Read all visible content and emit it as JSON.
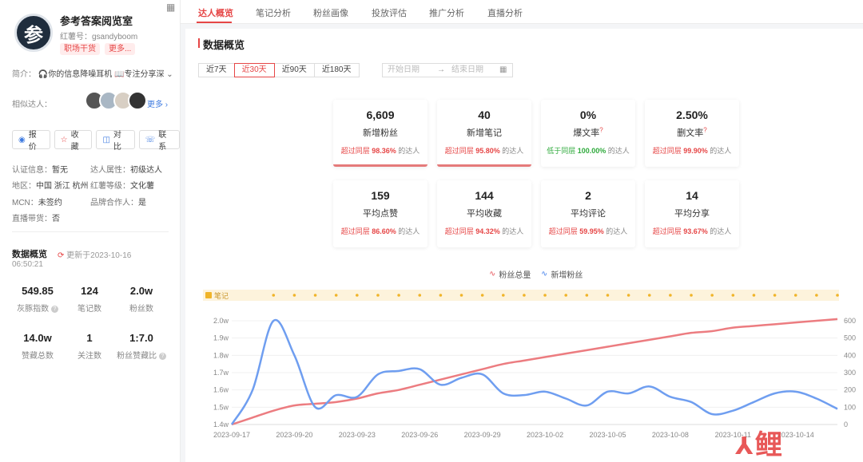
{
  "profile": {
    "avatar_char": "参",
    "name": "参考答案阅览室",
    "red_id": "红薯号：gsandyboom",
    "tags": [
      "职场干货",
      "更多..."
    ],
    "intro_label": "简介：",
    "intro_text": "🎧你的信息降噪耳机 📖专注分享深",
    "similar_label": "相似达人：",
    "more_label": "更多 ›",
    "actions": [
      "报价",
      "收藏",
      "对比",
      "联系"
    ],
    "info": {
      "cert_k": "认证信息：",
      "cert_v": "暂无",
      "attr_k": "达人属性：",
      "attr_v": "初级达人",
      "region_k": "地区：",
      "region_v": "中国 浙江 杭州",
      "level_k": "红薯等级：",
      "level_v": "文化薯",
      "mcn_k": "MCN：",
      "mcn_v": "未签约",
      "brand_k": "品牌合作人：",
      "brand_v": "是",
      "live_k": "直播带货：",
      "live_v": "否"
    },
    "overview_title": "数据概览",
    "updated": "更新于2023-10-16",
    "updated_time": "06:50:21",
    "stats": [
      {
        "value": "549.85",
        "label": "灰豚指数"
      },
      {
        "value": "124",
        "label": "笔记数"
      },
      {
        "value": "2.0w",
        "label": "粉丝数"
      },
      {
        "value": "14.0w",
        "label": "赞藏总数"
      },
      {
        "value": "1",
        "label": "关注数"
      },
      {
        "value": "1:7.0",
        "label": "粉丝赞藏比"
      }
    ]
  },
  "tabs": [
    "达人概览",
    "笔记分析",
    "粉丝画像",
    "投放评估",
    "推广分析",
    "直播分析"
  ],
  "section_title": "数据概览",
  "ranges": [
    "近7天",
    "近30天",
    "近90天",
    "近180天"
  ],
  "date_start": "开始日期",
  "date_end": "结束日期",
  "cards": [
    {
      "value": "6,609",
      "title": "新增粉丝",
      "pre": "超过同层",
      "pct": "98.36%",
      "post": "的达人"
    },
    {
      "value": "40",
      "title": "新增笔记",
      "pre": "超过同层",
      "pct": "95.80%",
      "post": "的达人"
    },
    {
      "value": "0%",
      "title": "爆文率",
      "pre": "低于同层",
      "pct": "100.00%",
      "post": "的达人"
    },
    {
      "value": "2.50%",
      "title": "删文率",
      "pre": "超过同层",
      "pct": "99.90%",
      "post": "的达人"
    },
    {
      "value": "159",
      "title": "平均点赞",
      "pre": "超过同层",
      "pct": "86.60%",
      "post": "的达人"
    },
    {
      "value": "144",
      "title": "平均收藏",
      "pre": "超过同层",
      "pct": "94.32%",
      "post": "的达人"
    },
    {
      "value": "2",
      "title": "平均评论",
      "pre": "超过同层",
      "pct": "59.95%",
      "post": "的达人"
    },
    {
      "value": "14",
      "title": "平均分享",
      "pre": "超过同层",
      "pct": "93.67%",
      "post": "的达人"
    }
  ],
  "watermark": "鲤",
  "colors": {
    "accent": "#e64646",
    "total_line": "#ec7c80",
    "new_line": "#6f9ef0",
    "note_band": "#fdf3dc",
    "note_dot": "#f0b429"
  },
  "chart_data": {
    "type": "line",
    "legend": [
      "粉丝总量",
      "新增粉丝"
    ],
    "note_label": "笔记",
    "x": [
      "2023-09-17",
      "2023-09-18",
      "2023-09-19",
      "2023-09-20",
      "2023-09-21",
      "2023-09-22",
      "2023-09-23",
      "2023-09-24",
      "2023-09-25",
      "2023-09-26",
      "2023-09-27",
      "2023-09-28",
      "2023-09-29",
      "2023-09-30",
      "2023-10-01",
      "2023-10-02",
      "2023-10-03",
      "2023-10-04",
      "2023-10-05",
      "2023-10-06",
      "2023-10-07",
      "2023-10-08",
      "2023-10-09",
      "2023-10-10",
      "2023-10-11",
      "2023-10-12",
      "2023-10-13",
      "2023-10-14",
      "2023-10-15",
      "2023-10-16"
    ],
    "x_tick_labels": [
      "2023-09-17",
      "2023-09-20",
      "2023-09-23",
      "2023-09-26",
      "2023-09-29",
      "2023-10-02",
      "2023-10-05",
      "2023-10-08",
      "2023-10-11",
      "2023-10-14"
    ],
    "y_left_ticks": [
      "1.4w",
      "1.5w",
      "1.6w",
      "1.7w",
      "1.8w",
      "1.9w",
      "2.0w"
    ],
    "y_left_range": [
      1.4,
      2.0
    ],
    "y_right_ticks": [
      "0",
      "100",
      "200",
      "300",
      "400",
      "500",
      "600"
    ],
    "y_right_range": [
      0,
      600
    ],
    "series": [
      {
        "name": "粉丝总量",
        "axis": "left",
        "values": [
          1.4,
          1.44,
          1.48,
          1.51,
          1.52,
          1.53,
          1.55,
          1.58,
          1.6,
          1.63,
          1.66,
          1.69,
          1.72,
          1.75,
          1.77,
          1.79,
          1.81,
          1.83,
          1.85,
          1.87,
          1.89,
          1.91,
          1.93,
          1.94,
          1.96,
          1.97,
          1.98,
          1.99,
          2.0,
          2.01
        ]
      },
      {
        "name": "新增粉丝",
        "axis": "right",
        "values": [
          0,
          200,
          600,
          400,
          100,
          170,
          160,
          290,
          310,
          320,
          230,
          270,
          290,
          180,
          170,
          190,
          150,
          110,
          190,
          180,
          220,
          160,
          130,
          60,
          80,
          130,
          180,
          190,
          150,
          90
        ]
      }
    ],
    "note_dates": [
      "2023-09-17",
      "2023-09-18",
      "2023-09-19",
      "2023-09-20",
      "2023-09-21",
      "2023-09-22",
      "2023-09-23",
      "2023-09-24",
      "2023-09-25",
      "2023-09-26",
      "2023-09-27",
      "2023-09-28",
      "2023-09-29",
      "2023-09-30",
      "2023-10-01",
      "2023-10-02",
      "2023-10-03",
      "2023-10-04",
      "2023-10-05",
      "2023-10-06",
      "2023-10-07",
      "2023-10-08",
      "2023-10-09",
      "2023-10-10",
      "2023-10-11",
      "2023-10-12",
      "2023-10-13",
      "2023-10-14",
      "2023-10-15",
      "2023-10-16"
    ]
  }
}
